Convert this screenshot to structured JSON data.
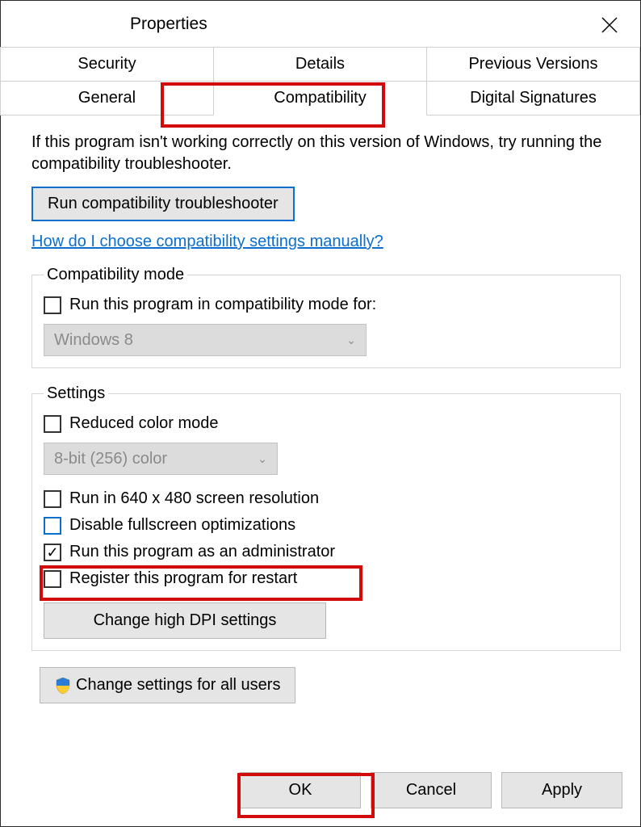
{
  "title": "Properties",
  "tabs": {
    "security": "Security",
    "details": "Details",
    "previous_versions": "Previous Versions",
    "general": "General",
    "compatibility": "Compatibility",
    "digital_signatures": "Digital Signatures"
  },
  "intro": "If this program isn't working correctly on this version of Windows, try running the compatibility troubleshooter.",
  "troubleshooter_btn": "Run compatibility troubleshooter",
  "manual_link": "How do I choose compatibility settings manually? ",
  "compat_mode": {
    "legend": "Compatibility mode",
    "checkbox": "Run this program in compatibility mode for:",
    "combo": "Windows 8"
  },
  "settings": {
    "legend": "Settings",
    "reduced_color": "Reduced color mode",
    "color_combo": "8-bit (256) color",
    "run_640": "Run in 640 x 480 screen resolution",
    "disable_fullscreen": "Disable fullscreen optimizations",
    "run_admin": "Run this program as an administrator",
    "register_restart": "Register this program for restart",
    "dpi_btn": "Change high DPI settings"
  },
  "all_users_btn": "Change settings for all users",
  "buttons": {
    "ok": "OK",
    "cancel": "Cancel",
    "apply": "Apply"
  }
}
